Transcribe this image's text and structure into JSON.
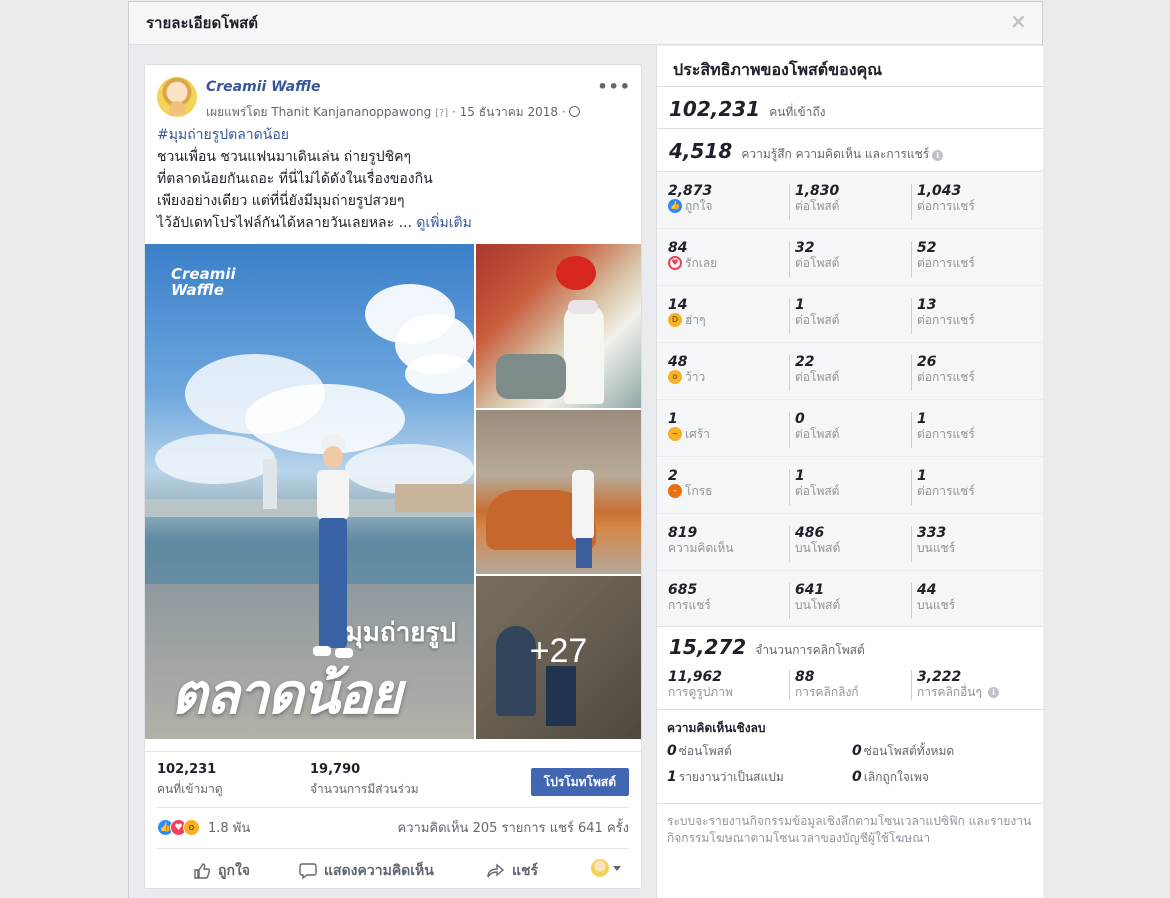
{
  "dialog": {
    "title": "รายละเอียดโพสต์",
    "close": "×"
  },
  "post": {
    "page_name": "Creamii Waffle",
    "published_by": "เผยแพร่โดย Thanit Kanjananoppawong",
    "help_mark": "[?]",
    "date": "15 ธันวาคม 2018",
    "more": "•••",
    "hashtag": "#มุมถ่ายรูปตลาดน้อย",
    "lines": [
      "ชวนเพื่อน ชวนแฟนมาเดินเล่น ถ่ายรูปชิคๆ",
      "ที่ตลาดน้อยกันเถอะ ที่นี่ไม่ได้ดังในเรื่องของกิน",
      "เพียงอย่างเดียว แต่ที่นี่ยังมีมุมถ่ายรูปสวยๆ",
      "ไว้อัปเดทโปรไฟล์กันได้หลายวันเลยหละ"
    ],
    "ellipsis": "...",
    "see_more": "ดูเพิ่มเติม",
    "photo_brand_1": "Creamii",
    "photo_brand_2": "Waffle",
    "photo_caption_1": "มุมถ่ายรูป",
    "photo_caption_2": "ตลาดน้อย",
    "more_photos": "+27",
    "reach_num": "102,231",
    "reach_label": "คนที่เข้ามาดู",
    "engage_num": "19,790",
    "engage_label": "จำนวนการมีส่วนร่วม",
    "boost": "โปรโมทโพสต์",
    "reaction_count": "1.8 พัน",
    "comments_shares": "ความคิดเห็น 205 รายการ  แชร์ 641 ครั้ง",
    "actions": {
      "like": "ถูกใจ",
      "comment": "แสดงความคิดเห็น",
      "share": "แชร์"
    }
  },
  "insights": {
    "title": "ประสิทธิภาพของโพสต์ของคุณ",
    "reach_num": "102,231",
    "reach_label": "คนที่เข้าถึง",
    "eng_num": "4,518",
    "eng_label": "ความรู้สึก ความคิดเห็น และการแชร์",
    "rows": [
      {
        "icon": "like-icon",
        "c0": [
          "2,873",
          "ถูกใจ"
        ],
        "c1": [
          "1,830",
          "ต่อโพสต์"
        ],
        "c2": [
          "1,043",
          "ต่อการแชร์"
        ]
      },
      {
        "icon": "love-icon",
        "c0": [
          "84",
          "รักเลย"
        ],
        "c1": [
          "32",
          "ต่อโพสต์"
        ],
        "c2": [
          "52",
          "ต่อการแชร์"
        ]
      },
      {
        "icon": "haha-icon",
        "c0": [
          "14",
          "ฮ่าๆ"
        ],
        "c1": [
          "1",
          "ต่อโพสต์"
        ],
        "c2": [
          "13",
          "ต่อการแชร์"
        ]
      },
      {
        "icon": "wow-icon",
        "c0": [
          "48",
          "ว้าว"
        ],
        "c1": [
          "22",
          "ต่อโพสต์"
        ],
        "c2": [
          "26",
          "ต่อการแชร์"
        ]
      },
      {
        "icon": "sad-icon",
        "c0": [
          "1",
          "เศร้า"
        ],
        "c1": [
          "0",
          "ต่อโพสต์"
        ],
        "c2": [
          "1",
          "ต่อการแชร์"
        ]
      },
      {
        "icon": "angry-icon",
        "c0": [
          "2",
          "โกรธ"
        ],
        "c1": [
          "1",
          "ต่อโพสต์"
        ],
        "c2": [
          "1",
          "ต่อการแชร์"
        ]
      },
      {
        "icon": "",
        "c0": [
          "819",
          "ความคิดเห็น"
        ],
        "c1": [
          "486",
          "บนโพสต์"
        ],
        "c2": [
          "333",
          "บนแชร์"
        ]
      },
      {
        "icon": "",
        "c0": [
          "685",
          "การแชร์"
        ],
        "c1": [
          "641",
          "บนโพสต์"
        ],
        "c2": [
          "44",
          "บนแชร์"
        ]
      }
    ],
    "clicks_num": "15,272",
    "clicks_label": "จำนวนการคลิกโพสต์",
    "click_cells": [
      [
        "11,962",
        "การดูรูปภาพ"
      ],
      [
        "88",
        "การคลิกลิงก์"
      ],
      [
        "3,222",
        "การคลิกอื่นๆ"
      ]
    ],
    "negative_title": "ความคิดเห็นเชิงลบ",
    "negative": [
      [
        "0",
        "ซ่อนโพสต์"
      ],
      [
        "0",
        "ซ่อนโพสต์ทั้งหมด"
      ],
      [
        "1",
        "รายงานว่าเป็นสแปม"
      ],
      [
        "0",
        "เลิกถูกใจเพจ"
      ]
    ],
    "note": "ระบบจะรายงานกิจกรรมข้อมูลเชิงลึกตามโซนเวลาแปซิฟิก และรายงานกิจกรรมโฆษณาตามโซนเวลาของบัญชีผู้ใช้โฆษณา"
  },
  "colors": {
    "accent": "#4267b2",
    "link": "#365899",
    "muted": "#90949c"
  }
}
